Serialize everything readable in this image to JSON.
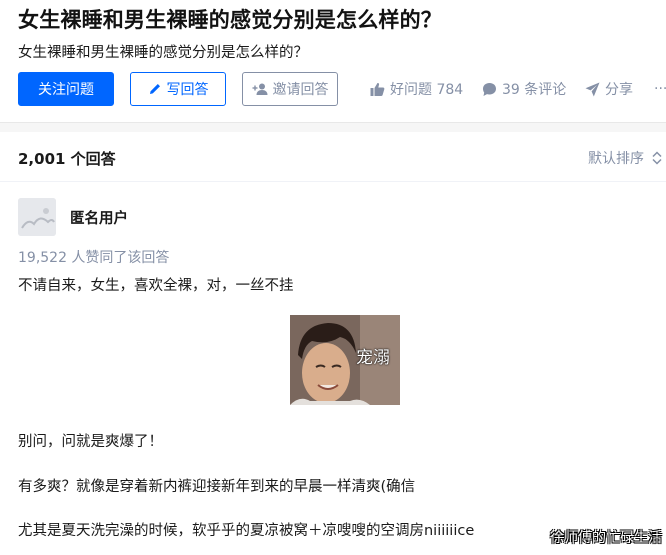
{
  "question": {
    "title": "女生裸睡和男生裸睡的感觉分别是怎么样的？",
    "detail": "女生裸睡和男生裸睡的感觉分别是怎么样的？"
  },
  "actions": {
    "follow_label": "关注问题",
    "write_label": "写回答",
    "invite_label": "邀请回答",
    "good_question_label": "好问题 784",
    "comments_label": "39 条评论",
    "share_label": "分享",
    "more_label": "···"
  },
  "answers_header": {
    "count_label": "2,001 个回答",
    "sort_label": "默认排序"
  },
  "answer": {
    "author_name": "匿名用户",
    "vote_info": "19,522 人赞同了该回答",
    "paragraphs": [
      "不请自来，女生，喜欢全裸，对，一丝不挂",
      "别问，问就是爽爆了！",
      "有多爽？就像是穿着新内裤迎接新年到来的早晨一样清爽(确信",
      "尤其是夏天洗完澡的时候，软乎乎的夏凉被窝＋凉嗖嗖的空调房niiiiiice"
    ],
    "image_caption": "宠溺"
  },
  "watermark": "徐师傅的忙碌生活",
  "colors": {
    "brand_blue": "#0066ff",
    "muted_gray": "#8590a6",
    "text": "#1a1a1a"
  },
  "icons": [
    "pen-icon",
    "invite-user-icon",
    "thumbs-up-icon",
    "comment-bubble-icon",
    "paper-plane-icon",
    "sort-arrows-icon"
  ]
}
